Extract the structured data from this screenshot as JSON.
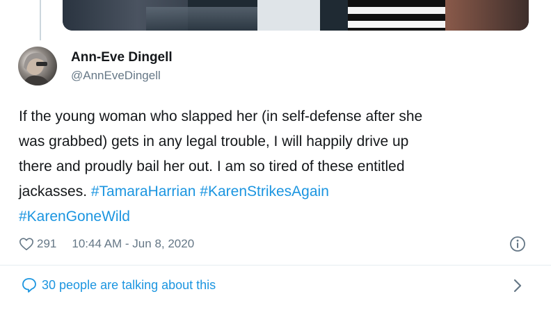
{
  "author": {
    "name": "Ann-Eve Dingell",
    "handle": "@AnnEveDingell"
  },
  "tweet": {
    "lines": [
      [
        {
          "text": "If the young woman who slapped her (in self-defense after she"
        }
      ],
      [
        {
          "text": "was grabbed) gets in any legal trouble, I will happily drive up"
        }
      ],
      [
        {
          "text": "there and proudly bail her out. I am so tired of these entitled"
        }
      ],
      [
        {
          "text": "jackasses. "
        },
        {
          "text": "#TamaraHarrian",
          "hashtag": true
        },
        {
          "text": " "
        },
        {
          "text": "#KarenStrikesAgain",
          "hashtag": true
        }
      ],
      [
        {
          "text": "#KarenGoneWild",
          "hashtag": true
        }
      ]
    ]
  },
  "stats": {
    "likes": "291",
    "timestamp": "10:44 AM - Jun 8, 2020"
  },
  "conversation": {
    "label": "30 people are talking about this"
  },
  "colors": {
    "link": "#1b95e0",
    "secondary": "#657786",
    "text": "#14171a"
  },
  "icons": [
    "heart-icon",
    "info-icon",
    "speech-bubble-icon",
    "chevron-right-icon"
  ]
}
